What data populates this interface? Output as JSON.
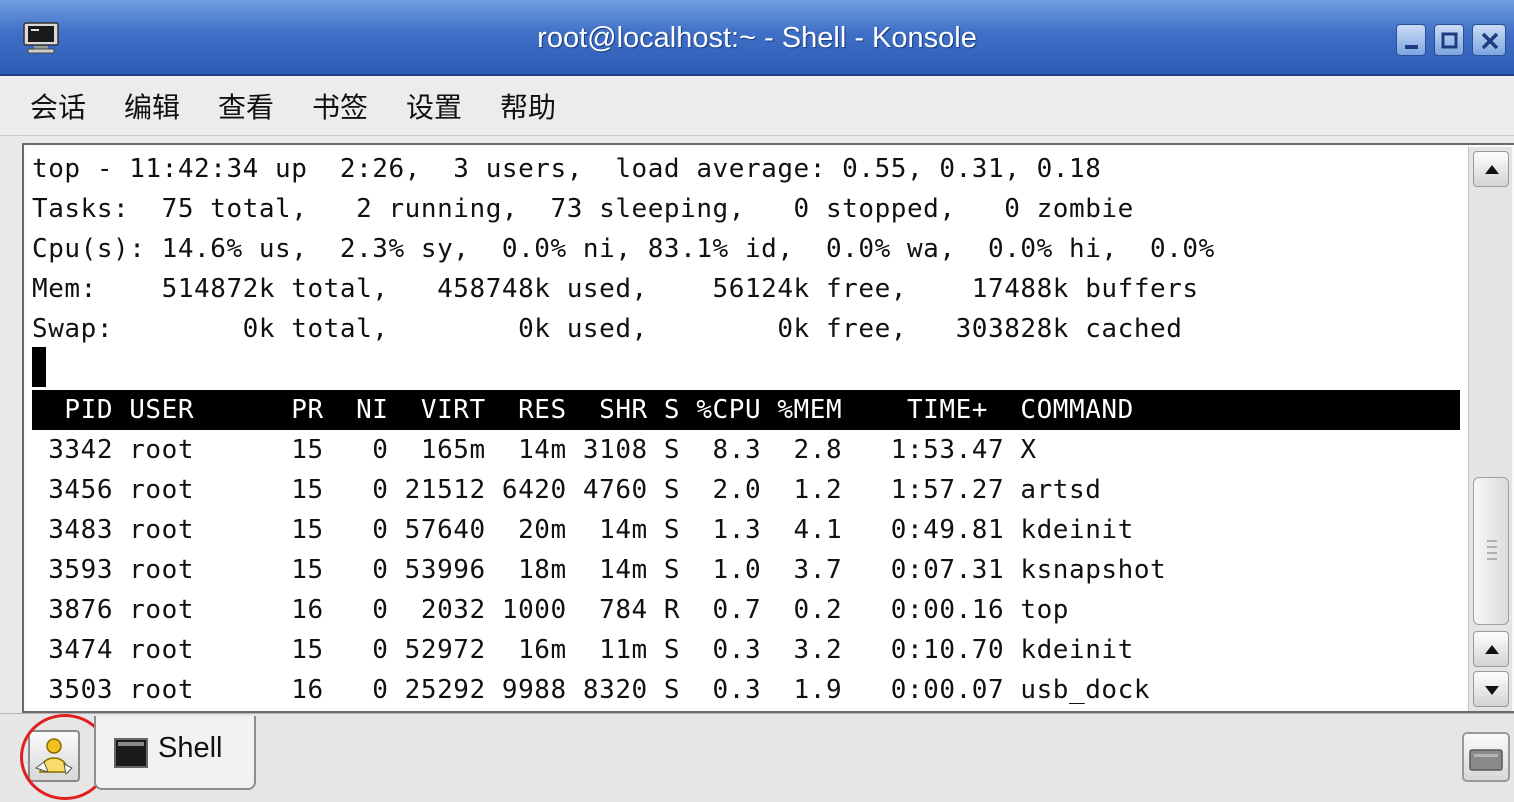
{
  "window": {
    "title": "root@localhost:~ - Shell - Konsole",
    "icon": "terminal-monitor-icon",
    "controls": [
      "minimize-icon",
      "maximize-icon",
      "close-icon"
    ]
  },
  "menu": {
    "items": [
      "会话",
      "编辑",
      "查看",
      "书签",
      "设置",
      "帮助"
    ]
  },
  "terminal": {
    "summary": [
      "top - 11:42:34 up  2:26,  3 users,  load average: 0.55, 0.31, 0.18",
      "Tasks:  75 total,   2 running,  73 sleeping,   0 stopped,   0 zombie",
      "Cpu(s): 14.6% us,  2.3% sy,  0.0% ni, 83.1% id,  0.0% wa,  0.0% hi,  0.0%",
      "Mem:    514872k total,   458748k used,    56124k free,    17488k buffers",
      "Swap:        0k total,        0k used,        0k free,   303828k cached"
    ],
    "process_header": "  PID USER      PR  NI  VIRT  RES  SHR S %CPU %MEM    TIME+  COMMAND",
    "processes": [
      " 3342 root      15   0  165m  14m 3108 S  8.3  2.8   1:53.47 X",
      " 3456 root      15   0 21512 6420 4760 S  2.0  1.2   1:57.27 artsd",
      " 3483 root      15   0 57640  20m  14m S  1.3  4.1   0:49.81 kdeinit",
      " 3593 root      15   0 53996  18m  14m S  1.0  3.7   0:07.31 ksnapshot",
      " 3876 root      16   0  2032 1000  784 R  0.7  0.2   0:00.16 top",
      " 3474 root      15   0 52972  16m  11m S  0.3  3.2   0:10.70 kdeinit",
      " 3503 root      16   0 25292 9988 8320 S  0.3  1.9   0:00.07 usb_dock"
    ]
  },
  "tabs": {
    "new_session_icon": "new-session-icon",
    "items": [
      {
        "label": "Shell",
        "icon": "terminal-icon"
      }
    ],
    "close_icon": "close-session-icon"
  },
  "colors": {
    "titlebar": "#3f6fc6",
    "annotation_circle": "#e02020",
    "terminal_bg": "#ffffff",
    "header_bg": "#000000"
  }
}
